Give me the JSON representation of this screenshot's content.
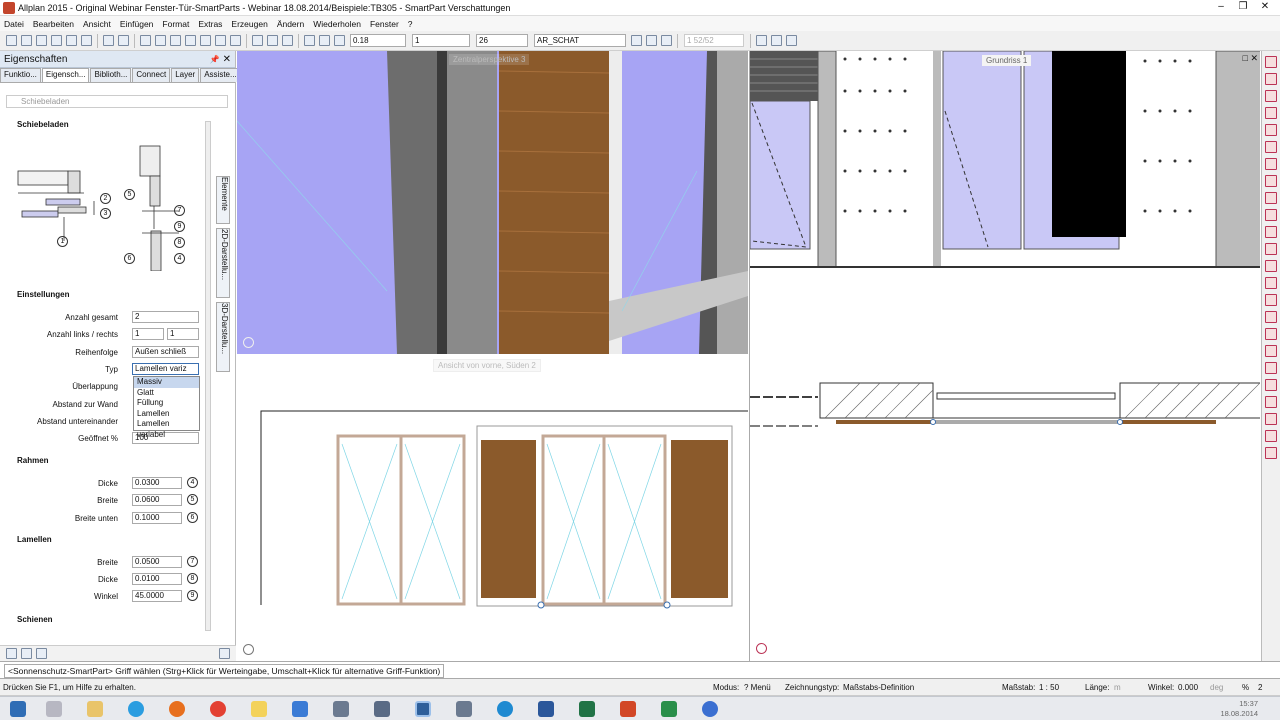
{
  "window": {
    "title": "Allplan 2015 - Original Webinar Fenster-Tür-SmartParts - Webinar 18.08.2014/Beispiele:TB305 - SmartPart Verschattungen",
    "controls": [
      "–",
      "❐",
      "✕"
    ]
  },
  "menu": [
    "Datei",
    "Bearbeiten",
    "Ansicht",
    "Einfügen",
    "Format",
    "Extras",
    "Erzeugen",
    "Ändern",
    "Wiederholen",
    "Fenster",
    "?"
  ],
  "toolbar": {
    "pen_thickness": "0.18",
    "line_type": "1",
    "color_index": "26",
    "layer": "AR_SCHAT",
    "scale_field": "1 52/52"
  },
  "panel": {
    "title": "Eigenschaften",
    "pin": "📌",
    "close": "✕",
    "tabs": [
      "Funktio...",
      "Eigensch...",
      "Biblioth...",
      "Connect",
      "Layer",
      "Assiste..."
    ],
    "active_tab": 1,
    "object_select": "Schiebeladen",
    "section_main": "Schiebeladen",
    "section_settings": "Einstellungen",
    "section_frame": "Rahmen",
    "section_slats": "Lamellen",
    "section_rails": "Schienen",
    "vertical_tabs": [
      "Elemente",
      "2D-Darstellu...",
      "3D-Darstellu..."
    ],
    "settings": {
      "anzahl_gesamt_label": "Anzahl gesamt",
      "anzahl_gesamt": "2",
      "anzahl_lr_label": "Anzahl links / rechts",
      "anzahl_links": "1",
      "anzahl_rechts": "1",
      "reihenfolge_label": "Reihenfolge",
      "reihenfolge": "Außen schließ",
      "typ_label": "Typ",
      "typ": "Lamellen variz",
      "ueberlappung_label": "Überlappung",
      "abstand_wand_label": "Abstand zur Wand",
      "abstand_unter_label": "Abstand untereinander",
      "geoeffnet_label": "Geöffnet %",
      "geoeffnet": "100"
    },
    "typ_options": [
      "Massiv",
      "Glatt",
      "Füllung",
      "Lamellen",
      "Lamellen variabel"
    ],
    "typ_options_highlight": 0,
    "frame": {
      "dicke_label": "Dicke",
      "dicke": "0.0300",
      "dicke_num": "4",
      "breite_label": "Breite",
      "breite": "0.0600",
      "breite_num": "5",
      "breite_unten_label": "Breite unten",
      "breite_unten": "0.1000",
      "breite_unten_num": "6"
    },
    "slats": {
      "breite_label": "Breite",
      "breite": "0.0500",
      "breite_num": "7",
      "dicke_label": "Dicke",
      "dicke": "0.0100",
      "dicke_num": "8",
      "winkel_label": "Winkel",
      "winkel": "45.0000",
      "winkel_num": "9"
    },
    "diagram_numbers": [
      "1",
      "2",
      "3",
      "4",
      "5",
      "6",
      "7",
      "8",
      "9"
    ]
  },
  "views": {
    "perspective": "Zentralperspektive 3",
    "front": "Ansicht von vorne, Süden 2",
    "plan": "Grundriss 1"
  },
  "command_line": "<Sonnenschutz-SmartPart> Griff wählen (Strg+Klick für Werteingabe, Umschalt+Klick für alternative Griff-Funktion)",
  "status": {
    "help": "Drücken Sie F1, um Hilfe zu erhalten.",
    "modus": "Modus:",
    "menu": "? Menü",
    "zeichnungstyp_label": "Zeichnungstyp:",
    "zeichnungstyp": "Maßstabs-Definition",
    "massstab_label": "Maßstab:",
    "massstab": "1 : 50",
    "laenge_label": "Länge:",
    "laenge_unit": "m",
    "winkel_label": "Winkel:",
    "winkel": "0.000",
    "winkel_unit": "deg",
    "prozent": "%",
    "prozent_val": "2"
  },
  "clock": {
    "time": "15:37",
    "date": "18.08.2014"
  },
  "colors": {
    "sky": "#a7a4f4",
    "wood": "#8b5a2b",
    "glass_line": "#7fd6e6",
    "accent": "#3a6fb0"
  }
}
